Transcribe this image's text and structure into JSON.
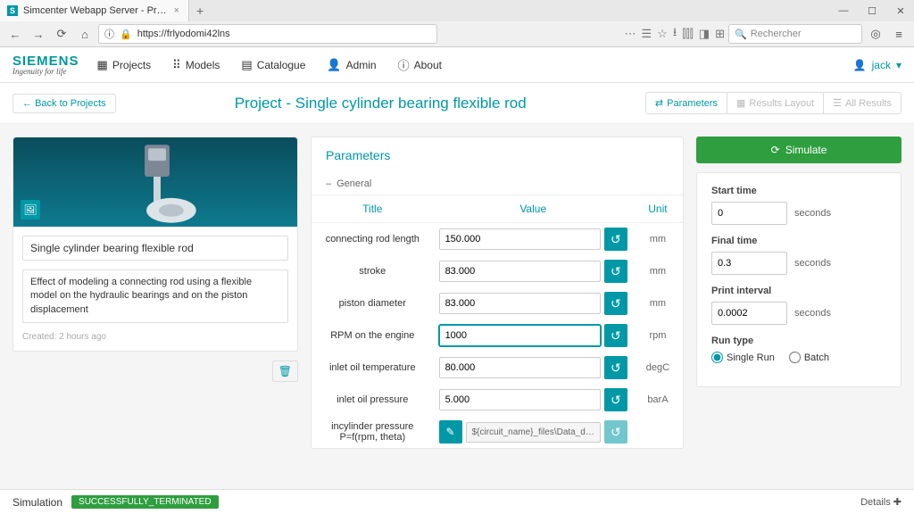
{
  "browser": {
    "tab_title": "Simcenter Webapp Server - Pr…",
    "url": "https://frlyodomi42lns",
    "search_placeholder": "Rechercher"
  },
  "brand": {
    "name": "SIEMENS",
    "tagline": "Ingenuity for life"
  },
  "nav": {
    "projects": "Projects",
    "models": "Models",
    "catalogue": "Catalogue",
    "admin": "Admin",
    "about": "About"
  },
  "user": {
    "name": "jack"
  },
  "topbar": {
    "back": "Back to Projects",
    "title": "Project - Single cylinder bearing flexible rod",
    "tabs": {
      "parameters": "Parameters",
      "results_layout": "Results Layout",
      "all_results": "All Results"
    }
  },
  "project": {
    "name": "Single cylinder bearing flexible rod",
    "description": "Effect of modeling a connecting rod using a flexible model on the hydraulic bearings and on the piston displacement",
    "created": "Created: 2 hours ago"
  },
  "params": {
    "panel_title": "Parameters",
    "section": "General",
    "headers": {
      "title": "Title",
      "value": "Value",
      "unit": "Unit"
    },
    "rows": [
      {
        "title": "connecting rod length",
        "value": "150.000",
        "unit": "mm"
      },
      {
        "title": "stroke",
        "value": "83.000",
        "unit": "mm"
      },
      {
        "title": "piston diameter",
        "value": "83.000",
        "unit": "mm"
      },
      {
        "title": "RPM on the engine",
        "value": "1000",
        "unit": "rpm",
        "active": true
      },
      {
        "title": "inlet oil temperature",
        "value": "80.000",
        "unit": "degC"
      },
      {
        "title": "inlet oil pressure",
        "value": "5.000",
        "unit": "barA"
      }
    ],
    "file_row": {
      "title": "incylinder pressure P=f(rpm, theta)",
      "value": "${circuit_name}_files\\Data_d…"
    }
  },
  "sim": {
    "button": "Simulate",
    "start_label": "Start time",
    "start_value": "0",
    "final_label": "Final time",
    "final_value": "0.3",
    "print_label": "Print interval",
    "print_value": "0.0002",
    "unit": "seconds",
    "runtype_label": "Run type",
    "single": "Single Run",
    "batch": "Batch"
  },
  "footer": {
    "label": "Simulation",
    "status": "SUCCESSFULLY_TERMINATED",
    "details": "Details"
  }
}
